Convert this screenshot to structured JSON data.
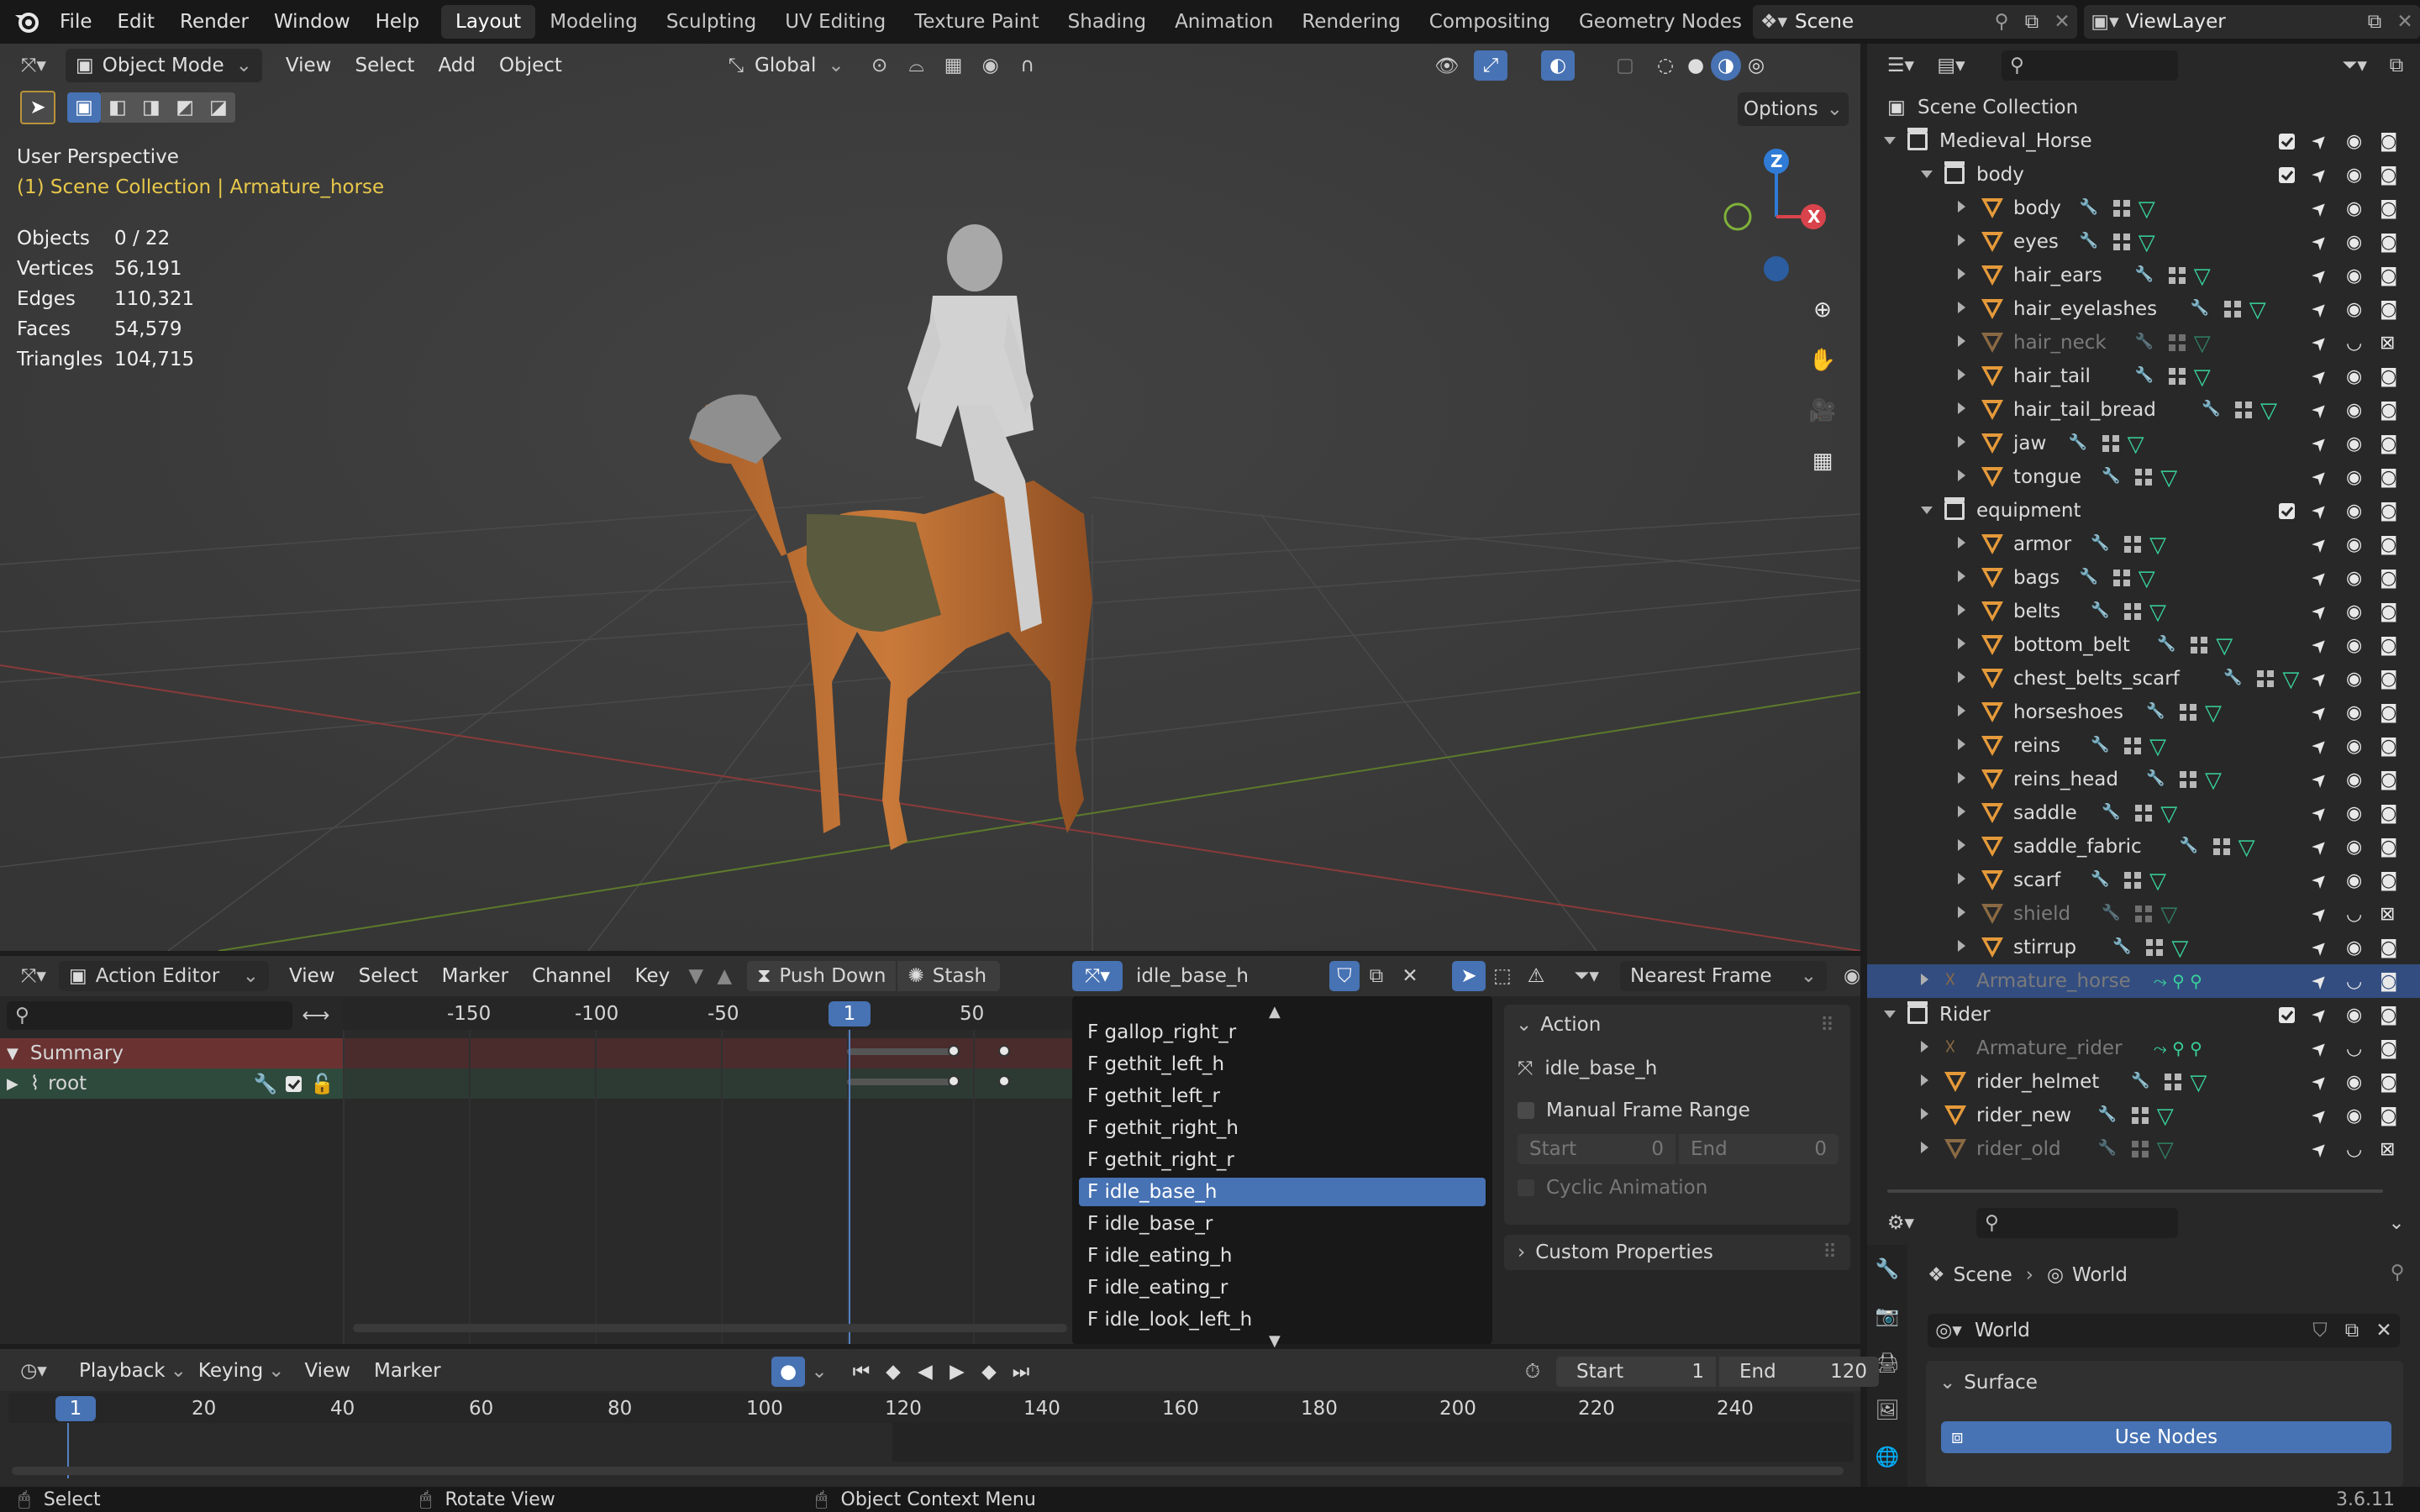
{
  "app": {
    "menu": [
      "File",
      "Edit",
      "Render",
      "Window",
      "Help"
    ],
    "workspaces": [
      "Layout",
      "Modeling",
      "Sculpting",
      "UV Editing",
      "Texture Paint",
      "Shading",
      "Animation",
      "Rendering",
      "Compositing",
      "Geometry Nodes"
    ],
    "active_workspace": "Layout",
    "scene": "Scene",
    "view_layer": "ViewLayer",
    "version": "3.6.11"
  },
  "viewport": {
    "mode": "Object Mode",
    "menus": [
      "View",
      "Select",
      "Add",
      "Object"
    ],
    "orientation": "Global",
    "options_label": "Options",
    "perspective": "User Perspective",
    "collection_info": "(1) Scene Collection | Armature_horse",
    "stats": [
      {
        "label": "Objects",
        "value": "0 / 22"
      },
      {
        "label": "Vertices",
        "value": "56,191"
      },
      {
        "label": "Edges",
        "value": "110,321"
      },
      {
        "label": "Faces",
        "value": "54,579"
      },
      {
        "label": "Triangles",
        "value": "104,715"
      }
    ],
    "gizmo": {
      "z": "Z",
      "x": "X"
    }
  },
  "outliner": {
    "root": "Scene Collection",
    "rows": [
      {
        "name": "Medieval_Horse",
        "type": "collection",
        "depth": 0,
        "expanded": true,
        "checkbox": true
      },
      {
        "name": "body",
        "type": "collection",
        "depth": 1,
        "expanded": true,
        "checkbox": true
      },
      {
        "name": "body",
        "type": "mesh",
        "depth": 2
      },
      {
        "name": "eyes",
        "type": "mesh",
        "depth": 2
      },
      {
        "name": "hair_ears",
        "type": "mesh",
        "depth": 2
      },
      {
        "name": "hair_eyelashes",
        "type": "mesh",
        "depth": 2
      },
      {
        "name": "hair_neck",
        "type": "mesh",
        "depth": 2,
        "hidden": true
      },
      {
        "name": "hair_tail",
        "type": "mesh",
        "depth": 2
      },
      {
        "name": "hair_tail_bread",
        "type": "mesh",
        "depth": 2
      },
      {
        "name": "jaw",
        "type": "mesh",
        "depth": 2
      },
      {
        "name": "tongue",
        "type": "mesh",
        "depth": 2
      },
      {
        "name": "equipment",
        "type": "collection",
        "depth": 1,
        "expanded": true,
        "checkbox": true
      },
      {
        "name": "armor",
        "type": "mesh",
        "depth": 2
      },
      {
        "name": "bags",
        "type": "mesh",
        "depth": 2
      },
      {
        "name": "belts",
        "type": "mesh",
        "depth": 2
      },
      {
        "name": "bottom_belt",
        "type": "mesh",
        "depth": 2
      },
      {
        "name": "chest_belts_scarf",
        "type": "mesh",
        "depth": 2
      },
      {
        "name": "horseshoes",
        "type": "mesh",
        "depth": 2
      },
      {
        "name": "reins",
        "type": "mesh",
        "depth": 2
      },
      {
        "name": "reins_head",
        "type": "mesh",
        "depth": 2
      },
      {
        "name": "saddle",
        "type": "mesh",
        "depth": 2
      },
      {
        "name": "saddle_fabric",
        "type": "mesh",
        "depth": 2
      },
      {
        "name": "scarf",
        "type": "mesh",
        "depth": 2
      },
      {
        "name": "shield",
        "type": "mesh",
        "depth": 2,
        "hidden": true
      },
      {
        "name": "stirrup",
        "type": "mesh",
        "depth": 2
      },
      {
        "name": "Armature_horse",
        "type": "armature",
        "depth": 1,
        "selected": true,
        "hidden": true
      },
      {
        "name": "Rider",
        "type": "collection",
        "depth": 0,
        "expanded": true,
        "checkbox": true
      },
      {
        "name": "Armature_rider",
        "type": "armature",
        "depth": 1,
        "hidden": true
      },
      {
        "name": "rider_helmet",
        "type": "mesh",
        "depth": 1
      },
      {
        "name": "rider_new",
        "type": "mesh",
        "depth": 1
      },
      {
        "name": "rider_old",
        "type": "mesh",
        "depth": 1,
        "hidden": true
      }
    ]
  },
  "properties": {
    "breadcrumb": [
      "Scene",
      "World"
    ],
    "world_name": "World",
    "surface_label": "Surface",
    "use_nodes": "Use Nodes"
  },
  "action_editor": {
    "mode": "Action Editor",
    "menus": [
      "View",
      "Select",
      "Marker",
      "Channel",
      "Key"
    ],
    "push_down": "Push Down",
    "stash": "Stash",
    "action_name": "idle_base_h",
    "snap": "Nearest Frame",
    "ruler": [
      "-150",
      "-100",
      "-50",
      "1",
      "50"
    ],
    "current_frame": "1",
    "channels": [
      {
        "name": "Summary"
      },
      {
        "name": "root"
      }
    ],
    "dropdown": [
      "F gallop_right_r",
      "F gethit_left_h",
      "F gethit_left_r",
      "F gethit_right_h",
      "F gethit_right_r",
      "F idle_base_h",
      "F idle_base_r",
      "F idle_eating_h",
      "F idle_eating_r",
      "F idle_look_left_h"
    ],
    "dropdown_selected": "F idle_base_h",
    "panel": {
      "title": "Action",
      "action": "idle_base_h",
      "manual_range": "Manual Frame Range",
      "start_label": "Start",
      "start_val": "0",
      "end_label": "End",
      "end_val": "0",
      "cyclic": "Cyclic Animation",
      "custom_props": "Custom Properties"
    }
  },
  "timeline": {
    "menus": [
      "Playback",
      "Keying",
      "View",
      "Marker"
    ],
    "start_label": "Start",
    "start": "1",
    "end_label": "End",
    "end": "120",
    "ruler": [
      "20",
      "40",
      "60",
      "80",
      "100",
      "120",
      "140",
      "160",
      "180",
      "200",
      "220",
      "240"
    ],
    "current_frame": "1"
  },
  "statusbar": {
    "items": [
      "Select",
      "Rotate View",
      "Object Context Menu"
    ]
  }
}
